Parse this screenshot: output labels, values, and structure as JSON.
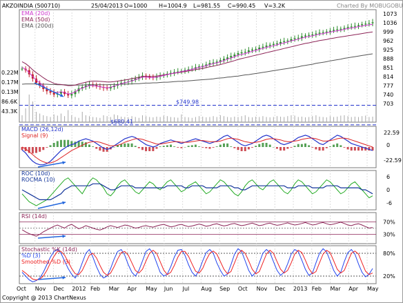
{
  "header": {
    "symbol": "AKZOINDIA (500710)",
    "date": "25/04/2013",
    "open": "O=1000",
    "high": "H=1004.9",
    "low": "L=981.55",
    "close": "C=990.45",
    "volume": "V=3.2K",
    "charted_by": "Charted By MOBUGOBU"
  },
  "footer": {
    "copyright": "Copyright @ 2013 ChartNexus",
    "brand": "ChartNexus"
  },
  "colors": {
    "candle_up": "#2a8a2a",
    "candle_down": "#c0202a",
    "ema20": "#cc33cc",
    "ema50": "#8b2255",
    "ema200": "#555555",
    "macd": "#2233cc",
    "signal": "#dd2222",
    "hist_pos": "#2a8a2a",
    "hist_neg": "#c0202a",
    "roc": "#22aa22",
    "rocma": "#113399",
    "rsi": "#8b2255",
    "stoch_k": "#8b2255",
    "stoch_d": "#2244ee",
    "stoch_smooth": "#ee2222",
    "hline": "#2233cc",
    "arrow": "#2266dd"
  },
  "chart_data": [
    {
      "type": "line",
      "panel": "price",
      "title": "AKZOINDIA (500710)",
      "legend": [
        "EMA (20d)",
        "EMA (50d)",
        "EMA (200d)"
      ],
      "y_ticks": [
        "1073",
        "1036",
        "999",
        "962",
        "925",
        "888",
        "851",
        "814",
        "777",
        "740",
        "703"
      ],
      "ylim": [
        690,
        1090
      ],
      "volume_ticks": [
        "0.22M",
        "0.17M",
        "0.13M",
        "86.6K",
        "43.3K"
      ],
      "hlines": [
        {
          "label": "$749.98",
          "value": 749.98
        },
        {
          "label": "$680.41",
          "value": 680.41
        }
      ],
      "x_months": [
        "Oct",
        "Nov",
        "Dec",
        "2012",
        "Feb",
        "Mar",
        "Apr",
        "May",
        "Jun",
        "Jul",
        "Aug",
        "Sep",
        "Oct",
        "Nov",
        "Dec",
        "2013",
        "Feb",
        "Mar",
        "Apr",
        "May"
      ],
      "close": [
        880,
        875,
        860,
        845,
        830,
        820,
        808,
        800,
        795,
        788,
        792,
        798,
        790,
        785,
        790,
        800,
        810,
        815,
        820,
        825,
        822,
        818,
        815,
        812,
        810,
        815,
        820,
        825,
        830,
        832,
        835,
        840,
        845,
        850,
        855,
        852,
        850,
        848,
        852,
        855,
        858,
        862,
        865,
        868,
        870,
        872,
        875,
        878,
        880,
        885,
        888,
        890,
        895,
        900,
        902,
        905,
        910,
        915,
        920,
        925,
        930,
        935,
        938,
        940,
        945,
        948,
        950,
        955,
        958,
        962,
        965,
        968,
        970,
        975,
        978,
        980,
        985,
        988,
        990,
        995,
        998,
        1000,
        1002,
        1005,
        1008,
        1010,
        1012,
        1015,
        1018,
        1020,
        1022,
        1025,
        1028,
        1030,
        1032,
        1035,
        1038,
        1040,
        1042,
        1045
      ],
      "ema20": [
        885,
        878,
        866,
        852,
        840,
        830,
        818,
        808,
        802,
        796,
        796,
        798,
        795,
        790,
        792,
        798,
        806,
        811,
        816,
        820,
        820,
        818,
        816,
        814,
        812,
        814,
        818,
        822,
        827,
        830,
        833,
        837,
        841,
        845,
        850,
        850,
        849,
        848,
        850,
        853,
        856,
        859,
        862,
        865,
        867,
        870,
        872,
        875,
        878,
        882,
        885,
        887,
        891,
        895,
        898,
        901,
        905,
        909,
        914,
        918,
        923,
        928,
        931,
        934,
        938,
        942,
        945,
        949,
        952,
        956,
        959,
        962,
        965,
        969,
        972,
        975,
        979,
        982,
        985,
        989,
        992,
        995,
        997,
        1000,
        1003,
        1005,
        1008,
        1010,
        1013,
        1015,
        1017,
        1020,
        1023,
        1025,
        1027,
        1030,
        1032,
        1034,
        1036,
        1038
      ],
      "ema50": [
        905,
        898,
        888,
        876,
        866,
        857,
        848,
        840,
        834,
        828,
        825,
        824,
        822,
        820,
        820,
        822,
        826,
        829,
        832,
        835,
        836,
        836,
        835,
        834,
        833,
        833,
        834,
        836,
        838,
        840,
        842,
        845,
        847,
        850,
        853,
        853,
        853,
        853,
        854,
        856,
        858,
        860,
        862,
        864,
        866,
        868,
        870,
        872,
        874,
        877,
        879,
        881,
        884,
        887,
        889,
        892,
        895,
        898,
        902,
        905,
        909,
        913,
        916,
        919,
        922,
        925,
        928,
        931,
        934,
        937,
        940,
        943,
        946,
        949,
        952,
        955,
        958,
        961,
        964,
        967,
        970,
        972,
        975,
        977,
        980,
        982,
        984,
        987,
        989,
        991,
        993,
        995,
        997,
        999,
        1001,
        1003,
        1005,
        1007,
        1009,
        1011
      ],
      "ema200": [
        825,
        826,
        826,
        826,
        826,
        826,
        825,
        825,
        824,
        824,
        823,
        823,
        823,
        822,
        822,
        822,
        822,
        822,
        823,
        823,
        823,
        823,
        823,
        823,
        823,
        824,
        824,
        824,
        825,
        825,
        826,
        826,
        827,
        827,
        828,
        829,
        829,
        830,
        830,
        831,
        832,
        832,
        833,
        834,
        835,
        835,
        836,
        837,
        838,
        839,
        840,
        841,
        842,
        843,
        844,
        846,
        847,
        848,
        850,
        851,
        853,
        854,
        856,
        858,
        859,
        861,
        863,
        865,
        867,
        869,
        871,
        873,
        875,
        877,
        879,
        881,
        883,
        885,
        887,
        890,
        892,
        894,
        896,
        899,
        901,
        903,
        905,
        908,
        910,
        912,
        914,
        917,
        919,
        921,
        923,
        925,
        927,
        929,
        931,
        933
      ],
      "volume": [
        40,
        80,
        160,
        120,
        60,
        50,
        40,
        35,
        30,
        45,
        38,
        50,
        35,
        70,
        40,
        30,
        25,
        60,
        40,
        35,
        30,
        28,
        25,
        40,
        35,
        30,
        45,
        40,
        32,
        30,
        28,
        35,
        30,
        25,
        40,
        35,
        30,
        28,
        32,
        30,
        38,
        35,
        30,
        28,
        26,
        45,
        30,
        28,
        25,
        30,
        35,
        32,
        28,
        30,
        35,
        30,
        40,
        35,
        30,
        28,
        32,
        30,
        35,
        40,
        30,
        28,
        32,
        30,
        35,
        30,
        28,
        30,
        35,
        32,
        30,
        35,
        40,
        38,
        30,
        32,
        28,
        30,
        35,
        40,
        32,
        30,
        28,
        35,
        30,
        32,
        38,
        40,
        35,
        30,
        32,
        30,
        35,
        38,
        30,
        32
      ]
    },
    {
      "type": "line",
      "panel": "macd",
      "legend": [
        "MACD (26,12d)",
        "Signal (9)"
      ],
      "y_ticks": [
        "22.59",
        "0",
        "-22.59"
      ],
      "ylim": [
        -35,
        35
      ],
      "macd": [
        -5,
        -10,
        -18,
        -24,
        -28,
        -30,
        -30,
        -28,
        -24,
        -18,
        -12,
        -6,
        -2,
        2,
        4,
        6,
        10,
        12,
        14,
        12,
        10,
        6,
        2,
        -2,
        -4,
        -2,
        2,
        6,
        10,
        14,
        16,
        18,
        16,
        12,
        8,
        4,
        2,
        0,
        2,
        6,
        8,
        10,
        12,
        10,
        8,
        6,
        8,
        10,
        12,
        14,
        12,
        10,
        8,
        6,
        8,
        10,
        14,
        18,
        20,
        16,
        12,
        8,
        4,
        2,
        4,
        6,
        10,
        14,
        18,
        20,
        18,
        14,
        10,
        6,
        4,
        6,
        8,
        12,
        16,
        18,
        20,
        18,
        14,
        10,
        6,
        4,
        8,
        12,
        16,
        20,
        18,
        14,
        10,
        6,
        4,
        2,
        0,
        -2,
        -4,
        -6
      ],
      "signal": [
        0,
        -3,
        -8,
        -13,
        -18,
        -22,
        -25,
        -27,
        -27,
        -25,
        -22,
        -18,
        -14,
        -10,
        -6,
        -3,
        0,
        3,
        6,
        8,
        9,
        9,
        8,
        6,
        4,
        2,
        2,
        3,
        5,
        8,
        10,
        12,
        14,
        14,
        13,
        11,
        9,
        7,
        5,
        5,
        6,
        7,
        8,
        9,
        9,
        8,
        8,
        8,
        9,
        10,
        11,
        11,
        10,
        9,
        9,
        9,
        10,
        12,
        14,
        15,
        14,
        13,
        11,
        9,
        8,
        7,
        8,
        9,
        11,
        13,
        14,
        14,
        13,
        12,
        10,
        9,
        9,
        10,
        11,
        13,
        14,
        15,
        15,
        14,
        12,
        10,
        10,
        11,
        12,
        14,
        15,
        15,
        14,
        12,
        10,
        8,
        6,
        4,
        2,
        0
      ]
    },
    {
      "type": "line",
      "panel": "roc",
      "legend": [
        "ROC (10d)",
        "ROCMA (10)"
      ],
      "y_ticks": [
        "6",
        "0",
        "-6"
      ],
      "ylim": [
        -9,
        9
      ],
      "roc": [
        -2,
        -4,
        -6,
        -7,
        -8,
        -7,
        -6,
        -5,
        -3,
        -1,
        1,
        3,
        5,
        6,
        4,
        2,
        0,
        -2,
        1,
        4,
        6,
        5,
        3,
        1,
        -2,
        -3,
        -1,
        2,
        4,
        5,
        3,
        1,
        -1,
        -2,
        0,
        2,
        4,
        3,
        1,
        0,
        2,
        4,
        5,
        3,
        1,
        -1,
        0,
        2,
        3,
        4,
        2,
        0,
        -2,
        -1,
        1,
        3,
        5,
        4,
        2,
        0,
        -2,
        -3,
        -1,
        2,
        4,
        5,
        3,
        1,
        0,
        2,
        4,
        5,
        3,
        1,
        -1,
        -2,
        0,
        3,
        5,
        4,
        2,
        0,
        -2,
        -1,
        1,
        3,
        5,
        4,
        2,
        0,
        -2,
        -1,
        1,
        3,
        4,
        2,
        0,
        -2,
        -4,
        -3
      ],
      "rocma": [
        0,
        -1,
        -2,
        -3,
        -4,
        -5,
        -5,
        -5,
        -5,
        -4,
        -3,
        -2,
        0,
        1,
        2,
        2,
        2,
        2,
        2,
        2,
        3,
        3,
        3,
        2,
        1,
        0,
        0,
        1,
        2,
        2,
        2,
        2,
        1,
        1,
        1,
        1,
        1,
        1,
        1,
        1,
        1,
        2,
        2,
        2,
        2,
        2,
        1,
        1,
        2,
        2,
        2,
        2,
        1,
        1,
        1,
        1,
        2,
        2,
        2,
        2,
        1,
        1,
        0,
        0,
        1,
        2,
        2,
        2,
        2,
        2,
        2,
        2,
        2,
        2,
        2,
        1,
        1,
        1,
        2,
        2,
        2,
        2,
        1,
        1,
        1,
        1,
        2,
        2,
        2,
        2,
        1,
        1,
        1,
        1,
        1,
        1,
        0,
        0,
        -1,
        -2
      ]
    },
    {
      "type": "line",
      "panel": "rsi",
      "legend": [
        "RSI (14d)"
      ],
      "y_ticks": [
        "70%",
        "30%"
      ],
      "ylim": [
        0,
        100
      ],
      "rsi": [
        45,
        38,
        32,
        28,
        24,
        30,
        38,
        44,
        50,
        56,
        60,
        55,
        50,
        58,
        62,
        55,
        48,
        52,
        58,
        54,
        50,
        46,
        44,
        48,
        54,
        58,
        55,
        52,
        56,
        60,
        58,
        54,
        50,
        52,
        56,
        58,
        55,
        53,
        57,
        60,
        62,
        58,
        54,
        56,
        60,
        62,
        58,
        55,
        57,
        60,
        63,
        60,
        56,
        58,
        62,
        64,
        60,
        57,
        59,
        63,
        65,
        61,
        58,
        60,
        63,
        66,
        62,
        58,
        60,
        64,
        66,
        62,
        59,
        61,
        64,
        67,
        63,
        60,
        62,
        65,
        68,
        64,
        60,
        62,
        66,
        68,
        64,
        61,
        63,
        66,
        69,
        65,
        60,
        58,
        62,
        64,
        60,
        55,
        50,
        52
      ]
    },
    {
      "type": "line",
      "panel": "stochastic",
      "legend": [
        "Stochastic %K (14d)",
        "%D (3)",
        "Smoothed %D (3)"
      ],
      "y_ticks": [
        "80%",
        "20%"
      ],
      "ylim": [
        0,
        100
      ],
      "k": [
        30,
        20,
        10,
        5,
        8,
        15,
        30,
        50,
        70,
        85,
        90,
        80,
        60,
        40,
        25,
        15,
        30,
        55,
        80,
        90,
        70,
        45,
        25,
        15,
        20,
        40,
        65,
        85,
        90,
        75,
        50,
        30,
        20,
        35,
        60,
        85,
        92,
        80,
        55,
        30,
        20,
        25,
        45,
        70,
        88,
        90,
        75,
        50,
        30,
        20,
        35,
        60,
        82,
        90,
        80,
        55,
        35,
        20,
        25,
        50,
        78,
        92,
        85,
        60,
        35,
        20,
        30,
        55,
        80,
        90,
        82,
        58,
        35,
        22,
        30,
        52,
        78,
        90,
        85,
        62,
        38,
        22,
        28,
        55,
        80,
        92,
        84,
        60,
        35,
        20,
        30,
        58,
        82,
        90,
        78,
        52,
        30,
        18,
        25,
        40
      ],
      "d": [
        35,
        28,
        20,
        12,
        10,
        12,
        20,
        35,
        55,
        72,
        85,
        85,
        75,
        58,
        40,
        26,
        24,
        35,
        55,
        75,
        80,
        68,
        48,
        30,
        22,
        28,
        45,
        65,
        82,
        85,
        75,
        55,
        35,
        28,
        38,
        60,
        80,
        88,
        80,
        58,
        36,
        24,
        30,
        48,
        70,
        85,
        85,
        72,
        52,
        33,
        28,
        40,
        62,
        80,
        86,
        78,
        58,
        38,
        26,
        32,
        55,
        78,
        88,
        80,
        60,
        38,
        26,
        32,
        55,
        78,
        88,
        80,
        58,
        38,
        28,
        35,
        55,
        78,
        88,
        82,
        62,
        40,
        26,
        32,
        55,
        78,
        88,
        82,
        60,
        38,
        28,
        35,
        58,
        80,
        86,
        78,
        55,
        33,
        24,
        28
      ]
    }
  ]
}
